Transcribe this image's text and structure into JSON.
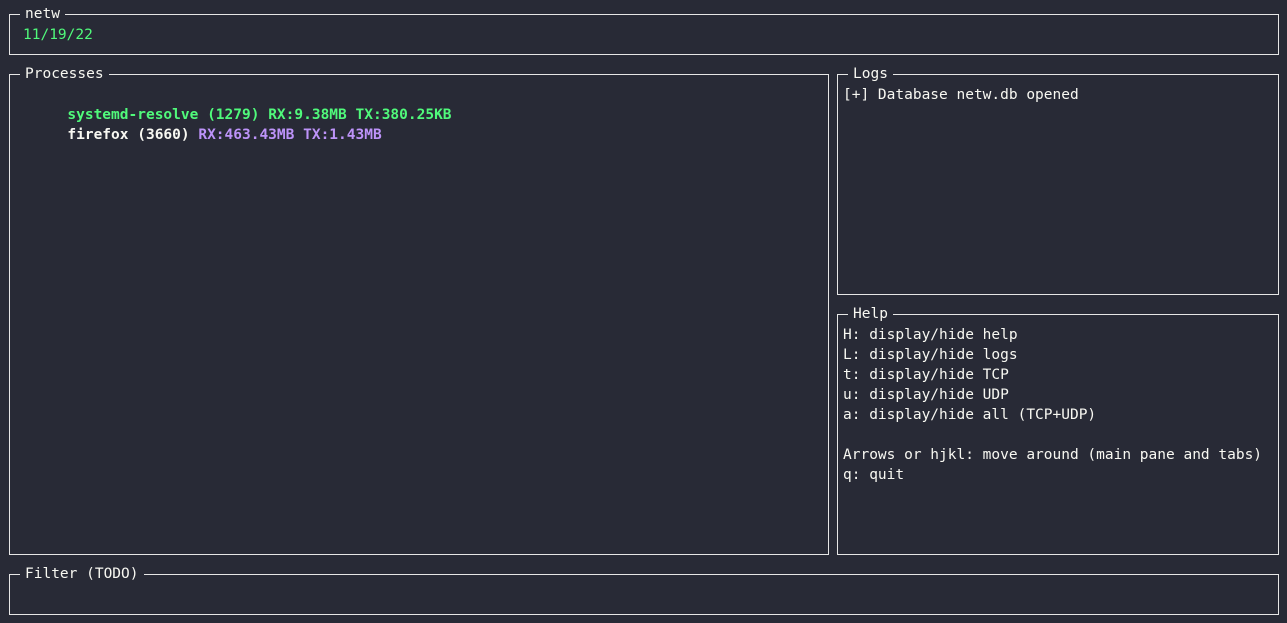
{
  "header": {
    "title": "netw",
    "date": "11/19/22"
  },
  "processes": {
    "title": "Processes",
    "rows": [
      {
        "name": "systemd-resolve (1279)",
        "rx": "RX:9.38MB",
        "tx": "TX:380.25KB",
        "selected": true
      },
      {
        "name": "firefox (3660)",
        "rx": "RX:463.43MB",
        "tx": "TX:1.43MB",
        "selected": false
      }
    ]
  },
  "logs": {
    "title": "Logs",
    "entries": [
      "[+] Database netw.db opened"
    ]
  },
  "help": {
    "title": "Help",
    "lines": [
      "H: display/hide help",
      "L: display/hide logs",
      "t: display/hide TCP",
      "u: display/hide UDP",
      "a: display/hide all (TCP+UDP)",
      "",
      "Arrows or hjkl: move around (main pane and tabs)",
      "q: quit"
    ]
  },
  "filter": {
    "title": "Filter (TODO)",
    "value": ""
  },
  "colors": {
    "background": "#282a36",
    "accent_green": "#50fa7b",
    "accent_purple": "#bd93f9",
    "border": "#e6e6e6"
  }
}
